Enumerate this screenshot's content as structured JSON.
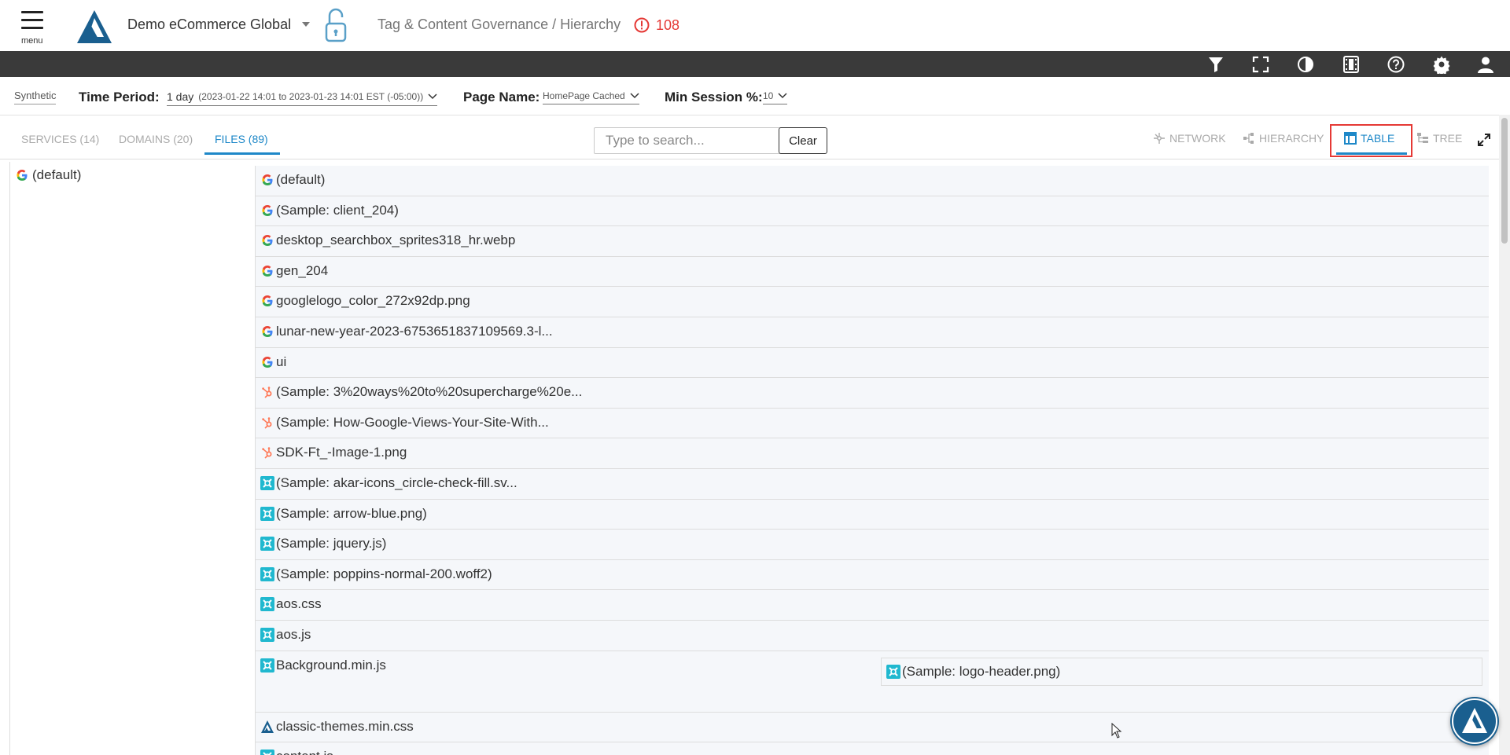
{
  "header": {
    "menu_label": "menu",
    "org_name": "Demo eCommerce Global",
    "breadcrumb": "Tag & Content Governance / Hierarchy",
    "alert_count": "108"
  },
  "filters": {
    "source": "Synthetic",
    "time_period_label": "Time Period:",
    "time_period_value": "1 day",
    "time_period_range": "(2023-01-22 14:01 to 2023-01-23 14:01 EST (-05:00))",
    "page_name_label": "Page Name:",
    "page_name_value": "HomePage Cached",
    "min_session_label": "Min Session %:",
    "min_session_value": "10"
  },
  "tabs": {
    "services": "SERVICES (14)",
    "domains": "DOMAINS (20)",
    "files": "FILES (89)"
  },
  "search": {
    "placeholder": "Type to search...",
    "clear_label": "Clear"
  },
  "views": {
    "network": "NETWORK",
    "hierarchy": "HIERARCHY",
    "table": "TABLE",
    "tree": "TREE"
  },
  "left": {
    "item": "(default)"
  },
  "rows": [
    {
      "icon": "google-icon",
      "label": "(default)"
    },
    {
      "icon": "google-icon",
      "label": "(Sample: client_204)"
    },
    {
      "icon": "google-icon",
      "label": "desktop_searchbox_sprites318_hr.webp"
    },
    {
      "icon": "google-icon",
      "label": "gen_204"
    },
    {
      "icon": "google-icon",
      "label": "googlelogo_color_272x92dp.png"
    },
    {
      "icon": "google-icon",
      "label": "lunar-new-year-2023-6753651837109569.3-l..."
    },
    {
      "icon": "google-icon",
      "label": "ui"
    },
    {
      "icon": "hubspot-icon",
      "label": "(Sample: 3%20ways%20to%20supercharge%20e..."
    },
    {
      "icon": "hubspot-icon",
      "label": "(Sample: How-Google-Views-Your-Site-With..."
    },
    {
      "icon": "hubspot-icon",
      "label": "SDK-Ft_-Image-1.png"
    },
    {
      "icon": "site-icon",
      "label": "(Sample: akar-icons_circle-check-fill.sv..."
    },
    {
      "icon": "site-icon",
      "label": "(Sample: arrow-blue.png)"
    },
    {
      "icon": "site-icon",
      "label": "(Sample: jquery.js)"
    },
    {
      "icon": "site-icon",
      "label": "(Sample: poppins-normal-200.woff2)"
    },
    {
      "icon": "site-icon",
      "label": "aos.css"
    },
    {
      "icon": "site-icon",
      "label": "aos.js"
    },
    {
      "icon": "site-icon",
      "label": "Background.min.js",
      "child": {
        "icon": "site-icon",
        "label": "(Sample: logo-header.png)"
      }
    },
    {
      "icon": "brand-icon",
      "label": "classic-themes.min.css"
    },
    {
      "icon": "site-icon",
      "label": "content.js"
    }
  ]
}
